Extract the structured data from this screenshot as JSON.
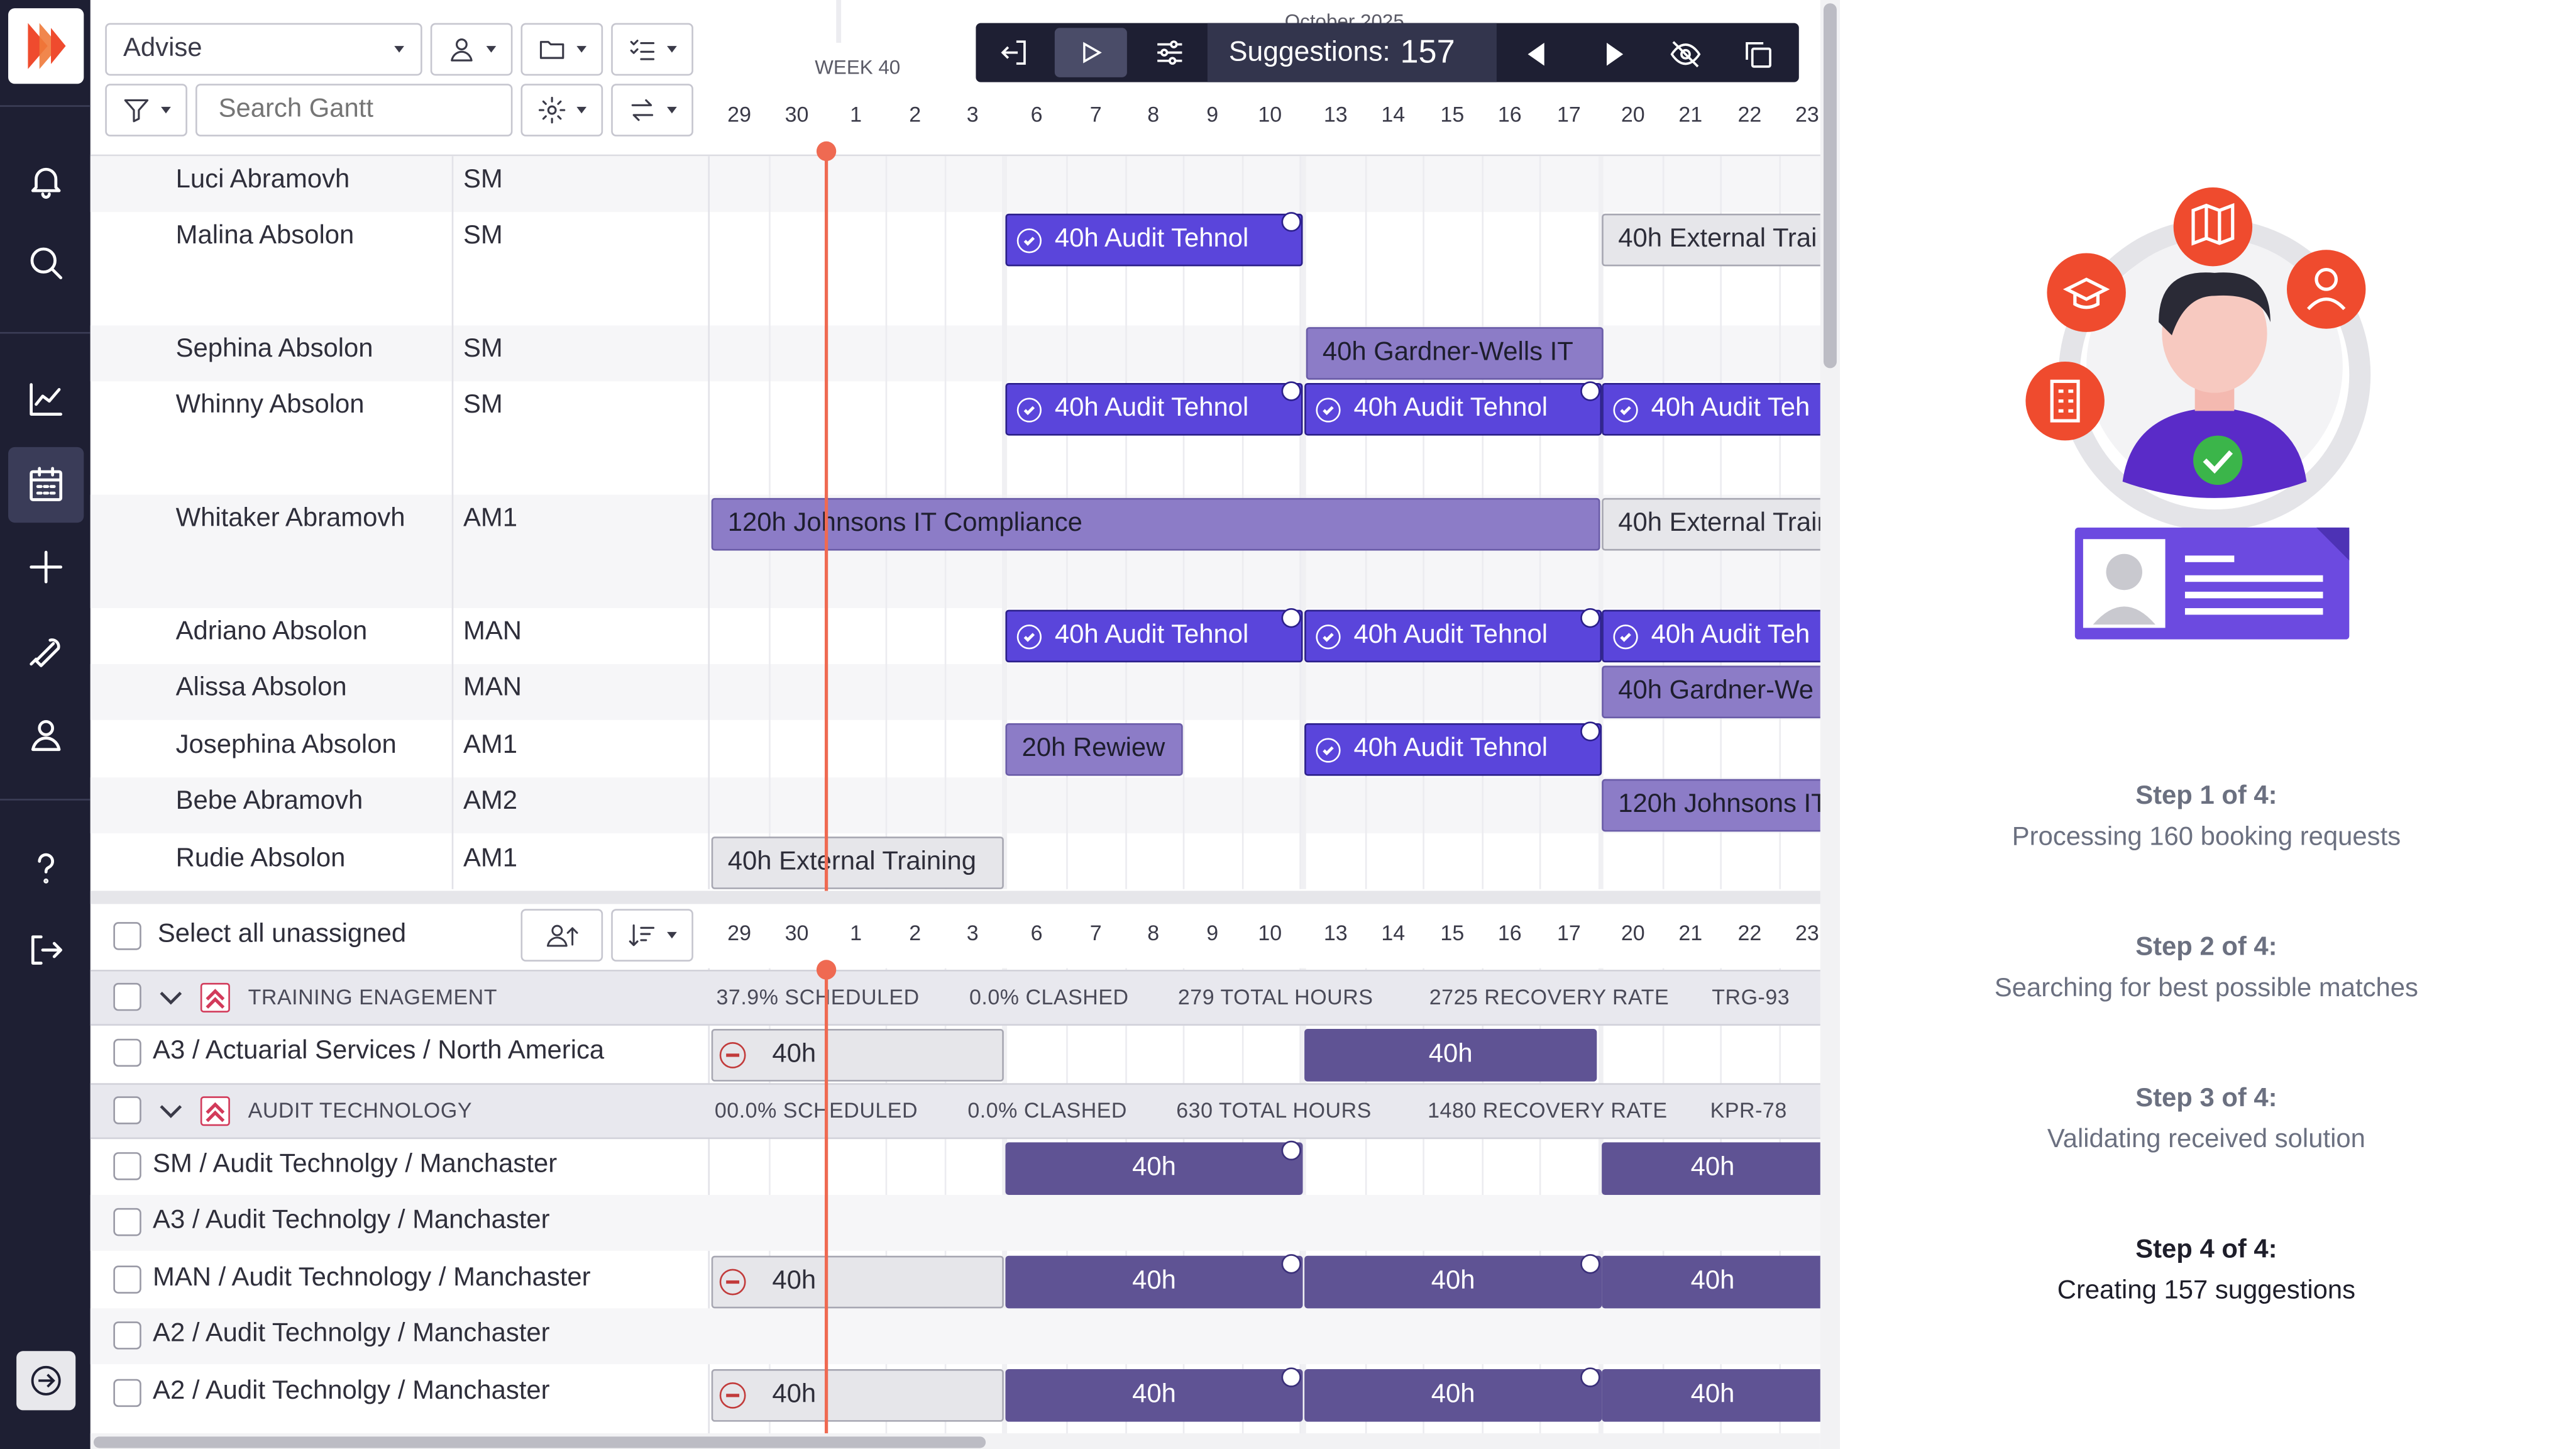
{
  "toolbar": {
    "view_select": "Advise",
    "search_placeholder": "Search Gantt",
    "month_label": "October 2025",
    "week_label": "WEEK 40",
    "suggestions_label": "Suggestions:",
    "suggestions_count": "157"
  },
  "days_top": [
    "29",
    "30",
    "1",
    "2",
    "3",
    "6",
    "7",
    "8",
    "9",
    "10",
    "13",
    "14",
    "15",
    "16",
    "17",
    "20",
    "21",
    "22",
    "23"
  ],
  "people": [
    {
      "name": "Luci Abramovh",
      "role": "SM"
    },
    {
      "name": "Malina Absolon",
      "role": "SM"
    },
    {
      "name": "Sephina Absolon",
      "role": "SM"
    },
    {
      "name": "Whinny Absolon",
      "role": "SM"
    },
    {
      "name": "Whitaker Abramovh",
      "role": "AM1"
    },
    {
      "name": "Adriano Absolon",
      "role": "MAN"
    },
    {
      "name": "Alissa Absolon",
      "role": "MAN"
    },
    {
      "name": "Josephina Absolon",
      "role": "AM1"
    },
    {
      "name": "Bebe Abramovh",
      "role": "AM2"
    },
    {
      "name": "Rudie Absolon",
      "role": "AM1"
    }
  ],
  "bars": {
    "audit": "40h Audit Tehnol",
    "audit_short": "40h Audit Teh",
    "external_trai": "40h External Trai",
    "external_train": "40h External Train",
    "external_training": "40h External Training",
    "gardner_wells": "40h Gardner-Wells IT",
    "gardner_we": "40h Gardner-We",
    "johnsons": "120h Johnsons IT Compliance",
    "johnsons_short": "120h Johnsons IT",
    "review": "20h Rewiew"
  },
  "unassigned": {
    "select_all": "Select all unassigned",
    "hours": "40h",
    "groups": [
      {
        "name": "TRAINING ENAGEMENT",
        "scheduled": "37.9% SCHEDULED",
        "clashed": "0.0% CLASHED",
        "total": "279 TOTAL HOURS",
        "recovery": "2725 RECOVERY RATE",
        "code": "TRG-93"
      },
      {
        "name": "AUDIT TECHNOLOGY",
        "scheduled": "00.0% SCHEDULED",
        "clashed": "0.0% CLASHED",
        "total": "630 TOTAL HOURS",
        "recovery": "1480 RECOVERY RATE",
        "code": "KPR-78"
      }
    ],
    "rows": [
      "A3 / Actuarial Services / North America",
      "SM / Audit Technolgy / Manchaster",
      "A3 / Audit Technolgy / Manchaster",
      "MAN / Audit Technology / Manchaster",
      "A2 / Audit Technolgy / Manchaster",
      "A2 / Audit Technolgy / Manchaster"
    ]
  },
  "steps": [
    {
      "title": "Step 1 of 4:",
      "desc": "Processing 160 booking requests"
    },
    {
      "title": "Step 2 of 4:",
      "desc": "Searching for best possible matches"
    },
    {
      "title": "Step 3 of 4:",
      "desc": "Validating received solution"
    },
    {
      "title": "Step 4 of 4:",
      "desc": "Creating 157 suggestions"
    }
  ],
  "colors": {
    "sidebar": "#1e1f33",
    "accent": "#ef4b2e",
    "suggestion": "#5a45db",
    "booking": "#8c7cc7",
    "unassigned": "#5f5394"
  }
}
